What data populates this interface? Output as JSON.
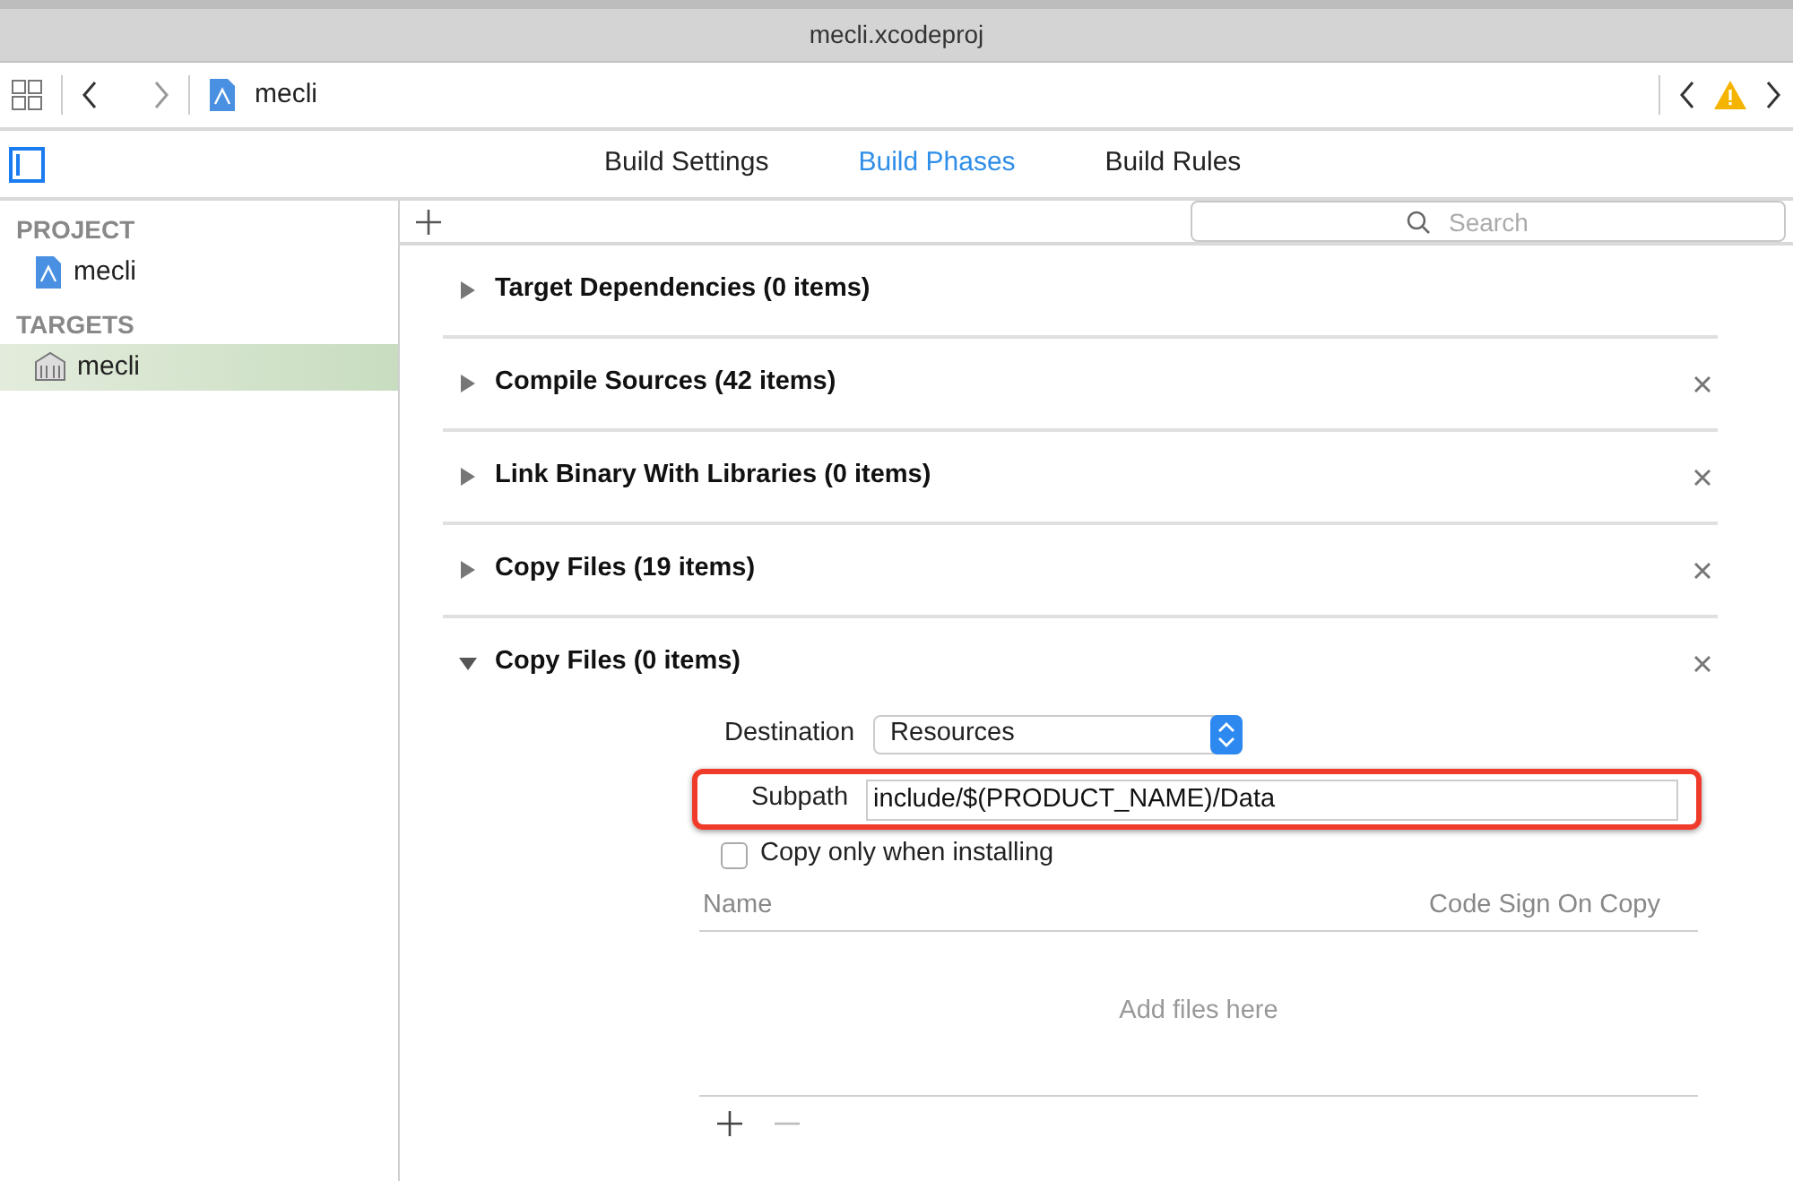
{
  "window": {
    "title": "mecli.xcodeproj"
  },
  "toolbar": {
    "breadcrumb": "mecli"
  },
  "tabs": [
    {
      "label": "Build Settings",
      "selected": false
    },
    {
      "label": "Build Phases",
      "selected": true
    },
    {
      "label": "Build Rules",
      "selected": false
    }
  ],
  "sidebar": {
    "sections": [
      {
        "heading": "PROJECT",
        "items": [
          {
            "label": "mecli",
            "kind": "project",
            "selected": false
          }
        ]
      },
      {
        "heading": "TARGETS",
        "items": [
          {
            "label": "mecli",
            "kind": "target",
            "selected": true
          }
        ]
      }
    ]
  },
  "search": {
    "placeholder": "Search"
  },
  "phases": [
    {
      "title": "Target Dependencies (0 items)",
      "expanded": false,
      "removable": false
    },
    {
      "title": "Compile Sources (42 items)",
      "expanded": false,
      "removable": true
    },
    {
      "title": "Link Binary With Libraries (0 items)",
      "expanded": false,
      "removable": true
    },
    {
      "title": "Copy Files (19 items)",
      "expanded": false,
      "removable": true
    },
    {
      "title": "Copy Files (0 items)",
      "expanded": true,
      "removable": true
    }
  ],
  "copy_files": {
    "destination_label": "Destination",
    "destination": "Resources",
    "subpath_label": "Subpath",
    "subpath": "include/$(PRODUCT_NAME)/Data",
    "subpath_highlighted": true,
    "copy_only_label": "Copy only when installing",
    "copy_only_checked": false,
    "columns": [
      "Name",
      "Code Sign On Copy"
    ],
    "empty_text": "Add files here"
  }
}
